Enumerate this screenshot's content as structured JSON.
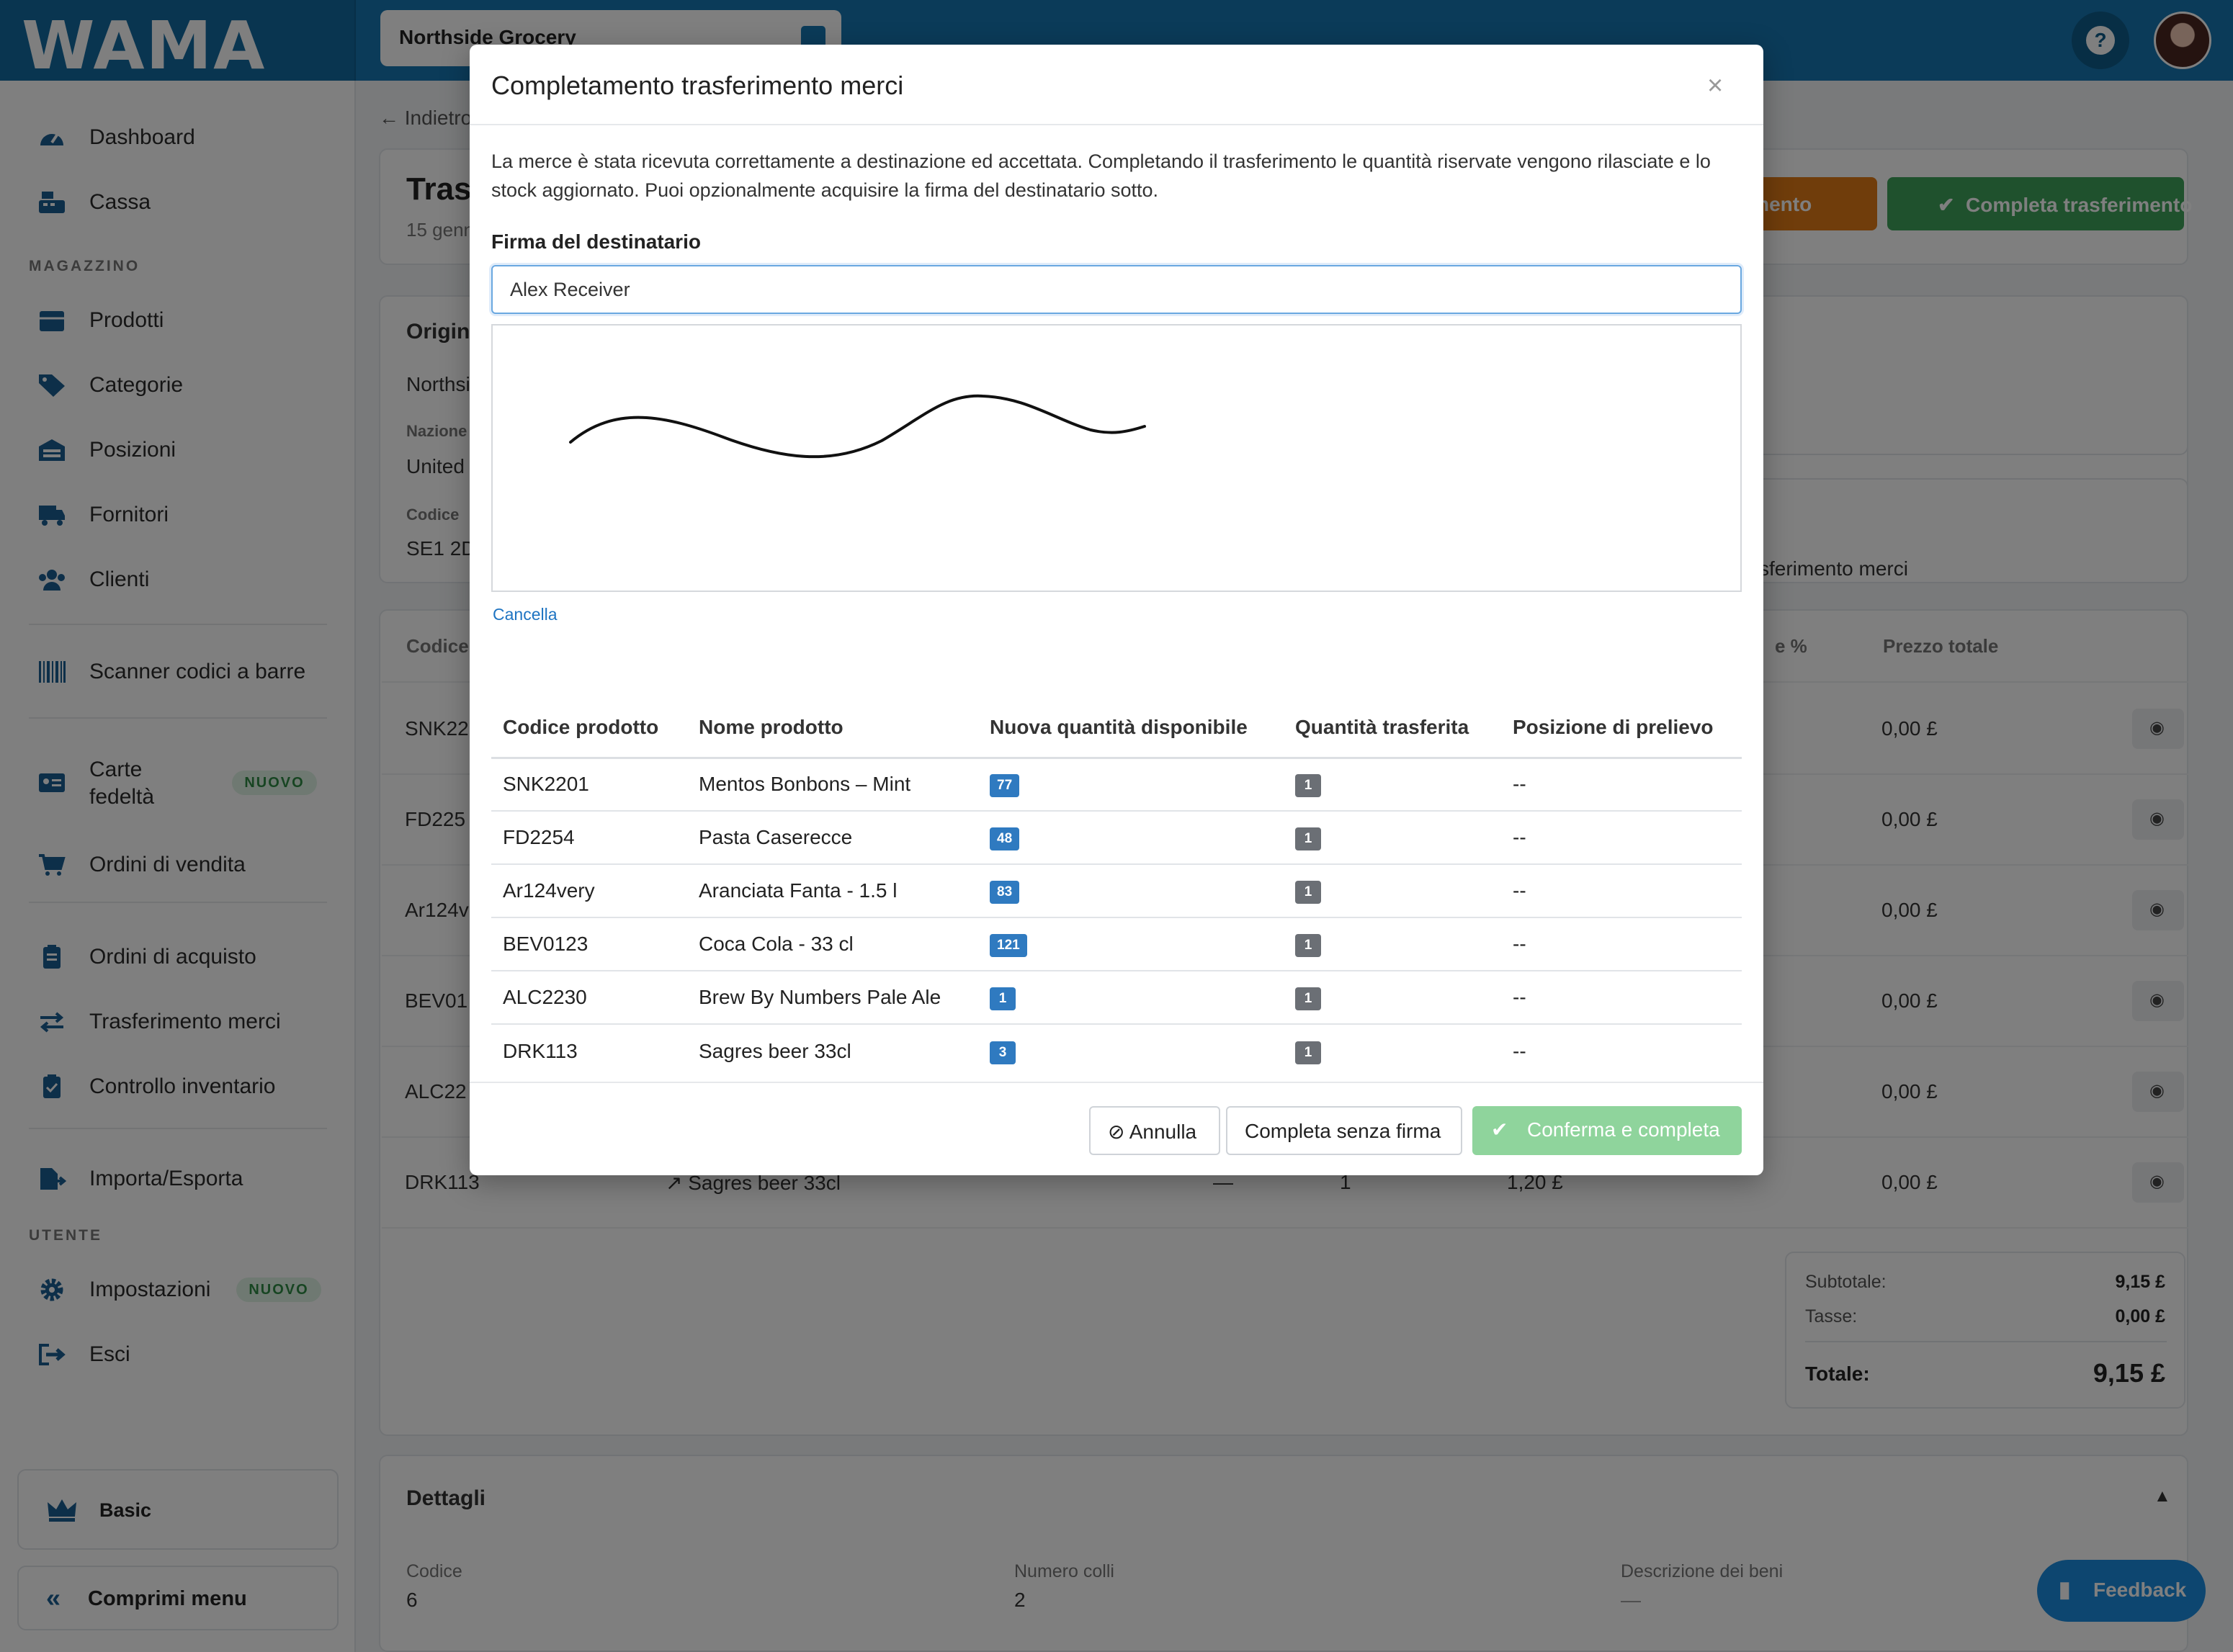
{
  "app": {
    "logo": "WAMA",
    "store": "Northside Grocery"
  },
  "sidebar": {
    "items": [
      {
        "label": "Dashboard",
        "icon": "gauge-icon"
      },
      {
        "label": "Cassa",
        "icon": "cash-register-icon"
      }
    ],
    "section_magazzino": "MAGAZZINO",
    "magazzino_items": [
      {
        "label": "Prodotti",
        "icon": "box-icon"
      },
      {
        "label": "Categorie",
        "icon": "tags-icon"
      },
      {
        "label": "Posizioni",
        "icon": "warehouse-icon"
      },
      {
        "label": "Fornitori",
        "icon": "truck-icon"
      },
      {
        "label": "Clienti",
        "icon": "users-icon"
      },
      {
        "label": "Scanner codici a barre",
        "icon": "barcode-icon"
      },
      {
        "label": "Carte\nfedeltà",
        "icon": "id-card-icon",
        "badge": "NUOVO"
      },
      {
        "label": "Ordini di vendita",
        "icon": "cart-icon"
      },
      {
        "label": "Ordini di acquisto",
        "icon": "clipboard-list-icon"
      },
      {
        "label": "Trasferimento merci",
        "icon": "transfer-arrows-icon"
      },
      {
        "label": "Controllo inventario",
        "icon": "clipboard-check-icon"
      },
      {
        "label": "Importa/Esporta",
        "icon": "file-export-icon"
      }
    ],
    "section_utente": "UTENTE",
    "utente_items": [
      {
        "label": "Impostazioni",
        "icon": "gear-icon",
        "badge": "NUOVO"
      },
      {
        "label": "Esci",
        "icon": "sign-out-icon"
      }
    ],
    "plan": "Basic",
    "collapse": "Comprimi menu"
  },
  "background": {
    "back": "Indietro",
    "title": "Tras",
    "subtitle": "15 genn",
    "btn_orange": "Trasferimento",
    "btn_green": "Completa trasferimento",
    "origin_title": "Origine",
    "origin_name": "Northside",
    "nation_label": "Nazione",
    "nation_value": "United",
    "code_label": "Codice",
    "code_value": "SE1 2D",
    "right_text": "sferimento merci",
    "col_codice": "Codice",
    "col_sconto": "e %",
    "col_prezzo_totale": "Prezzo totale",
    "rows": [
      {
        "code": "SNK22",
        "total": "0,00 £"
      },
      {
        "code": "FD225",
        "total": "0,00 £"
      },
      {
        "code": "Ar124v",
        "total": "0,00 £"
      },
      {
        "code": "BEV01",
        "total": "0,00 £"
      },
      {
        "code": "ALC22",
        "total": "0,00 £"
      },
      {
        "code": "DRK113",
        "name": "Sagres beer 33cl",
        "dash": "—",
        "qty": "1",
        "price": "1,20 £",
        "total": "0,00 £"
      }
    ],
    "totals": {
      "subtotal_label": "Subtotale:",
      "subtotal": "9,15 £",
      "tax_label": "Tasse:",
      "tax": "0,00 £",
      "total_label": "Totale:",
      "total": "9,15 £"
    },
    "details": {
      "title": "Dettagli",
      "codice_label": "Codice",
      "codice_value": "6",
      "colli_label": "Numero colli",
      "colli_value": "2",
      "desc_label": "Descrizione dei beni",
      "desc_value": "—"
    },
    "feedback": "Feedback"
  },
  "modal": {
    "title": "Completamento trasferimento merci",
    "close": "×",
    "description": "La merce è stata ricevuta correttamente a destinazione ed accettata. Completando il trasferimento le quantità riservate vengono rilasciate e lo stock aggiornato. Puoi opzionalmente acquisire la firma del destinatario sotto.",
    "signature_label": "Firma del destinatario",
    "signature_name": "Alex Receiver",
    "clear_link": "Cancella",
    "table": {
      "headers": [
        "Codice prodotto",
        "Nome prodotto",
        "Nuova quantità disponibile",
        "Quantità trasferita",
        "Posizione di prelievo"
      ],
      "rows": [
        {
          "code": "SNK2201",
          "name": "Mentos Bonbons – Mint",
          "available": "77",
          "transferred": "1",
          "location": "--"
        },
        {
          "code": "FD2254",
          "name": "Pasta Caserecce",
          "available": "48",
          "transferred": "1",
          "location": "--"
        },
        {
          "code": "Ar124very",
          "name": "Aranciata Fanta - 1.5 l",
          "available": "83",
          "transferred": "1",
          "location": "--"
        },
        {
          "code": "BEV0123",
          "name": "Coca Cola - 33 cl",
          "available": "121",
          "transferred": "1",
          "location": "--"
        },
        {
          "code": "ALC2230",
          "name": "Brew By Numbers Pale Ale",
          "available": "1",
          "transferred": "1",
          "location": "--"
        },
        {
          "code": "DRK113",
          "name": "Sagres beer 33cl",
          "available": "3",
          "transferred": "1",
          "location": "--"
        }
      ]
    },
    "buttons": {
      "cancel": "Annulla",
      "complete_no_sig": "Completa senza firma",
      "confirm": "Conferma e completa"
    }
  }
}
